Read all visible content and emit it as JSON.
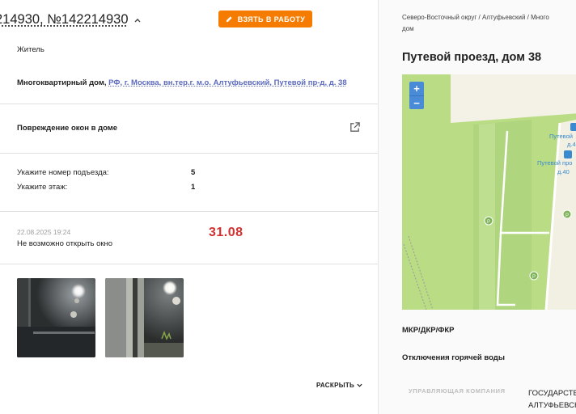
{
  "left_panel": {
    "title": "214930, №142214930",
    "take_button_label": "ВЗЯТЬ В РАБОТУ",
    "author_type": "Житель",
    "address_prefix": "Многоквартирный дом,",
    "address_link": "РФ, г. Москва, вн.тер.г. м.о. Алтуфьевский, Путевой пр-д, д. 38",
    "problem": "Повреждение окон в доме",
    "fields": [
      {
        "label": "Укажите номер подъезда:",
        "value": "5"
      },
      {
        "label": "Укажите этаж:",
        "value": "1"
      }
    ],
    "message": {
      "datetime": "22.08.2025 19:24",
      "text": "Не возможно открыть окно",
      "annotation": "31.08"
    },
    "expand_label": "РАСКРЫТЬ"
  },
  "right_panel": {
    "breadcrumbs_line1": "Северо-Восточный округ / Алтуфьевский / Много",
    "breadcrumbs_line2": "дом",
    "title": "Путевой проезд, дом 38",
    "map": {
      "zoom_in": "+",
      "zoom_out": "−",
      "labels": [
        "Путевой",
        "д.4",
        "Путевой про",
        "д.40"
      ]
    },
    "rows": [
      {
        "label": "МКР/ДКР/ФКР"
      },
      {
        "label": "Отключения горячей воды"
      }
    ],
    "table": {
      "column_header": "УПРАВЛЯЮЩАЯ КОМПАНИЯ",
      "value_line1": "ГОСУДАРСТВ",
      "value_line2": "АЛТУФЬЕВСК"
    }
  },
  "colors": {
    "accent_orange": "#f57c00",
    "link_blue": "#5c6bc0",
    "annotation_red": "#d32f2f",
    "map_green": "#b9dc84"
  }
}
